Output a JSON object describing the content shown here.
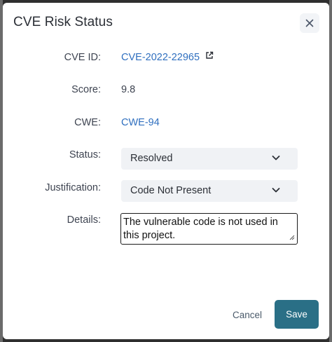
{
  "modal": {
    "title": "CVE Risk Status"
  },
  "fields": {
    "cve_id": {
      "label": "CVE ID:",
      "value": "CVE-2022-22965"
    },
    "score": {
      "label": "Score:",
      "value": "9.8"
    },
    "cwe": {
      "label": "CWE:",
      "value": "CWE-94"
    },
    "status": {
      "label": "Status:",
      "value": "Resolved"
    },
    "justification": {
      "label": "Justification:",
      "value": "Code Not Present"
    },
    "details": {
      "label": "Details:",
      "value": "The vulnerable code is not used in this project."
    }
  },
  "footer": {
    "cancel_label": "Cancel",
    "save_label": "Save"
  },
  "icons": {
    "close": "close-icon",
    "external_link": "external-link-icon",
    "chevron": "chevron-down-icon"
  },
  "colors": {
    "link": "#2f6fbf",
    "primary": "#2a6f86",
    "select_bg": "#f0f2f5"
  }
}
